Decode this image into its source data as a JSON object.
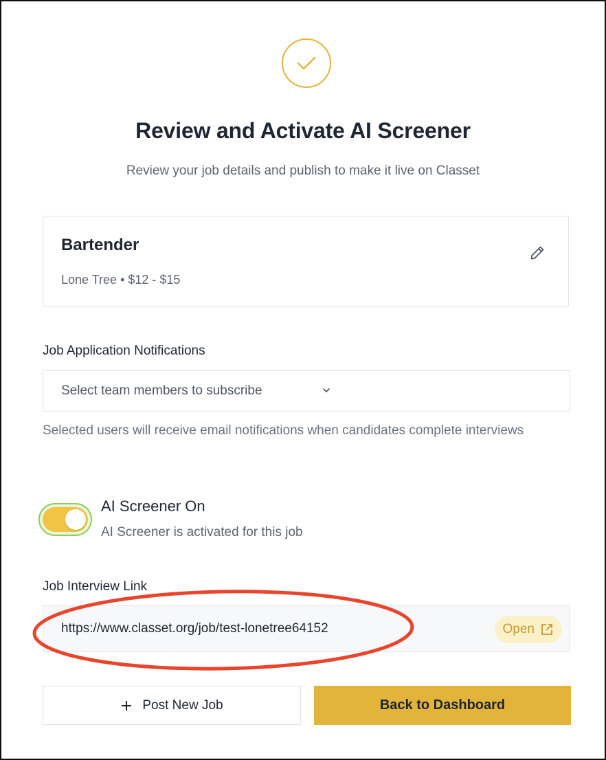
{
  "header": {
    "icon": "check-circle-icon",
    "title": "Review and Activate AI Screener",
    "subtitle": "Review your job details and publish to make it live on Classet"
  },
  "job": {
    "title": "Bartender",
    "meta": "Lone Tree • $12 - $15",
    "edit_icon": "pencil-icon"
  },
  "notifications": {
    "label": "Job Application Notifications",
    "placeholder": "Select team members to subscribe",
    "helper": "Selected users will receive email notifications when candidates complete interviews"
  },
  "screener": {
    "enabled": true,
    "title": "AI Screener On",
    "description": "AI Screener is activated for this job"
  },
  "interview_link": {
    "label": "Job Interview Link",
    "url": "https://www.classet.org/job/test-lonetree64152",
    "open_label": "Open",
    "open_icon": "external-link-icon"
  },
  "actions": {
    "post_new_label": "Post New Job",
    "post_new_icon": "plus-icon",
    "back_label": "Back to Dashboard"
  },
  "colors": {
    "accent": "#e2b53a",
    "toggle_on": "#f2c444",
    "annotation": "#e8452c"
  }
}
